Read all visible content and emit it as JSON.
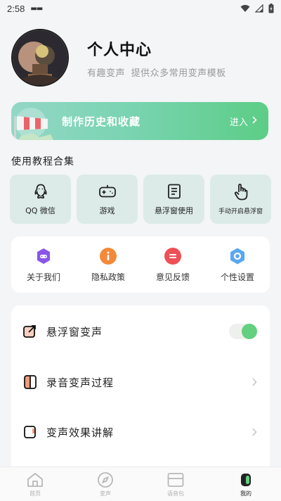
{
  "status_bar": {
    "time": "2:58",
    "notification": "▬▬"
  },
  "profile": {
    "title": "个人中心",
    "subtitle": "有趣变声 提供众多常用变声模板"
  },
  "history_banner": {
    "title": "制作历史和收藏",
    "enter_label": "进入"
  },
  "tutorials": {
    "section_title": "使用教程合集",
    "items": [
      {
        "label": "QQ 微信",
        "icon": "qq-icon"
      },
      {
        "label": "游戏",
        "icon": "gamepad-icon"
      },
      {
        "label": "悬浮窗使用",
        "icon": "document-icon"
      },
      {
        "label": "手动开启悬浮窗",
        "icon": "hand-pointer-icon"
      }
    ]
  },
  "quick_links": [
    {
      "label": "关于我们",
      "icon": "about-icon",
      "color": "#8a55e8"
    },
    {
      "label": "隐私政策",
      "icon": "info-icon",
      "color": "#f28a3a"
    },
    {
      "label": "意见反馈",
      "icon": "feedback-icon",
      "color": "#ee4f57"
    },
    {
      "label": "个性设置",
      "icon": "settings-icon",
      "color": "#5aa7ef"
    }
  ],
  "settings": {
    "items": [
      {
        "label": "悬浮窗变声",
        "icon": "floating-window-icon",
        "toggle_on": true
      },
      {
        "label": "录音变声过程",
        "icon": "recording-icon"
      },
      {
        "label": "变声效果讲解",
        "icon": "effect-icon"
      }
    ]
  },
  "bottom_nav": {
    "items": [
      {
        "label": "首页",
        "icon": "home-icon"
      },
      {
        "label": "变声",
        "icon": "compass-icon"
      },
      {
        "label": "语音包",
        "icon": "voice-pack-icon"
      },
      {
        "label": "我的",
        "icon": "profile-icon",
        "active": true
      }
    ]
  },
  "colors": {
    "accent_green": "#62d07f",
    "banner_start": "#93d7c6",
    "banner_end": "#5ccd86",
    "card_bg": "#dcebe8"
  }
}
